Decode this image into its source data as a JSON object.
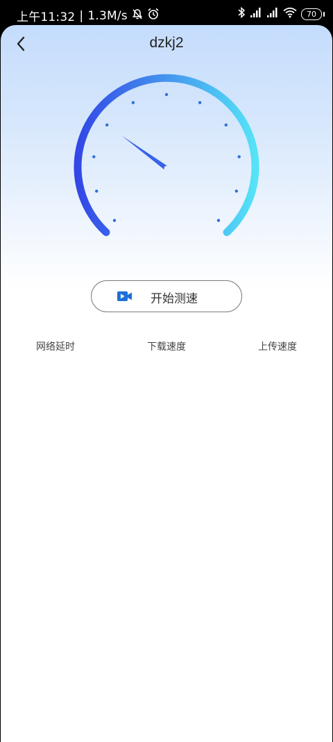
{
  "status_bar": {
    "time": "上午11:32",
    "network_speed": "1.3M/s",
    "battery": "70",
    "icons": [
      "mute-bell-icon",
      "alarm-icon",
      "bluetooth-icon",
      "signal-icon",
      "signal-icon",
      "wifi-icon",
      "battery-icon"
    ]
  },
  "header": {
    "title": "dzkj2",
    "back_icon": "chevron-left-icon"
  },
  "gauge": {
    "needle_level": 0.3,
    "colors": {
      "start": "#3347e6",
      "end": "#55e3f7",
      "ticks": "#2f6fd6"
    }
  },
  "start_button": {
    "label": "开始测速",
    "icon": "video-camera-icon",
    "icon_color": "#1f6fd6"
  },
  "metrics": [
    {
      "label": "网络延时"
    },
    {
      "label": "下载速度"
    },
    {
      "label": "上传速度"
    }
  ]
}
